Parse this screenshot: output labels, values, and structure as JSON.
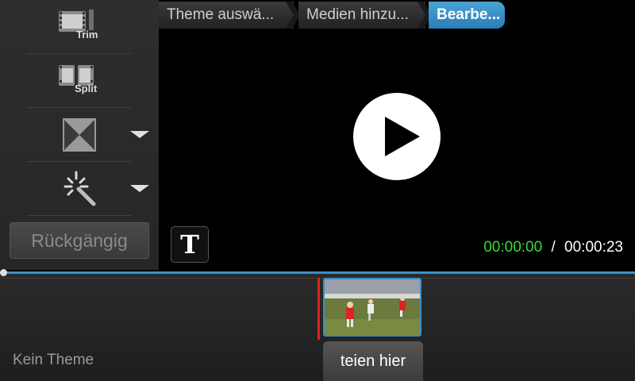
{
  "toolbar": {
    "trim_label": "Trim",
    "split_label": "Split",
    "transition_icon": "transition-icon",
    "effects_icon": "magic-wand-icon",
    "undo_label": "Rückgängig"
  },
  "breadcrumb": {
    "items": [
      {
        "label": "Theme auswä..."
      },
      {
        "label": "Medien hinzu..."
      },
      {
        "label": "Bearbe..."
      }
    ]
  },
  "preview": {
    "title_button_label": "T",
    "time_current": "00:00:00",
    "time_separator": "/",
    "time_total": "00:00:23"
  },
  "timeline": {
    "theme_label": "Kein Theme",
    "drop_hint": "teien hier"
  },
  "colors": {
    "accent": "#3a8fc9",
    "time_current": "#33dd33",
    "playhead": "#e02020"
  }
}
